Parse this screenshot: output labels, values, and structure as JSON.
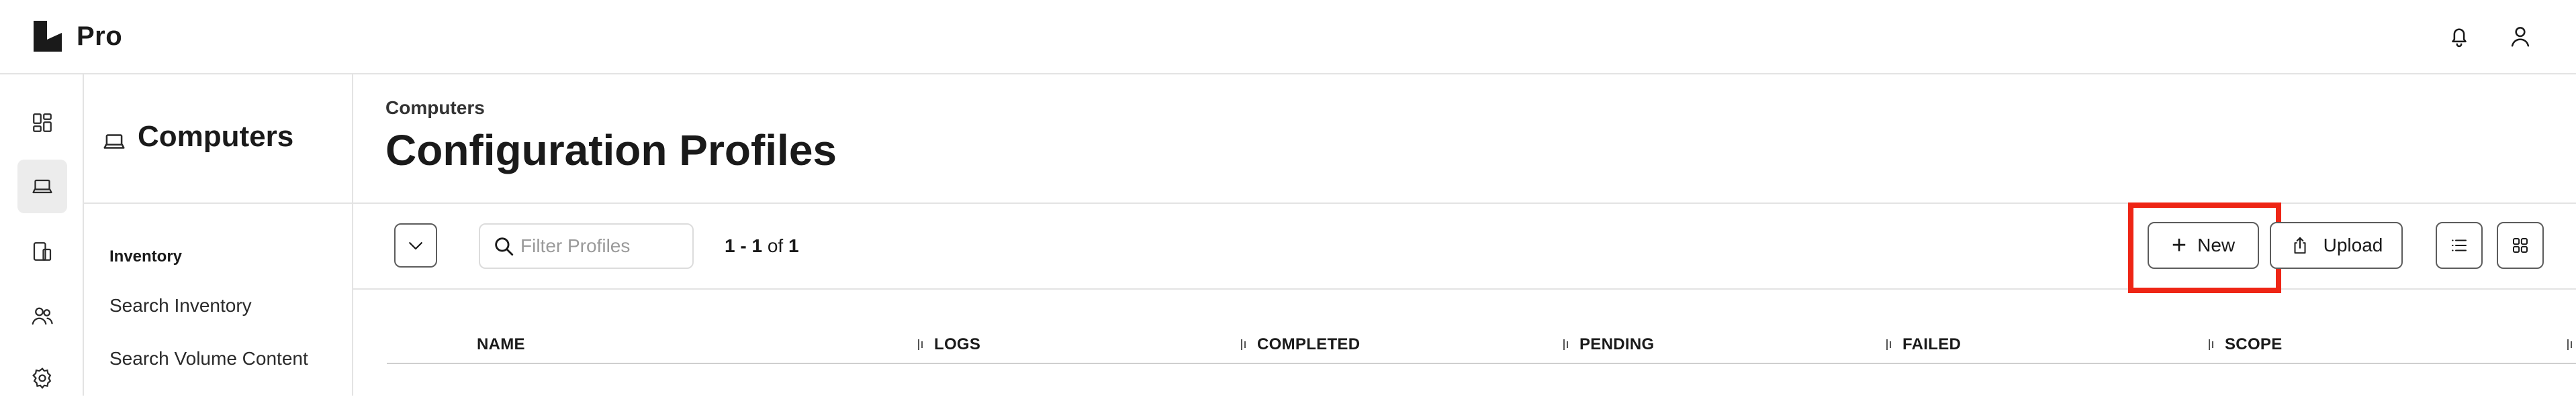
{
  "app": {
    "name": "Pro"
  },
  "sidebar_section": {
    "title": "Computers",
    "group_label": "Inventory",
    "links": [
      "Search Inventory",
      "Search Volume Content"
    ]
  },
  "page": {
    "breadcrumb": "Computers",
    "title": "Configuration Profiles"
  },
  "toolbar": {
    "filter_placeholder": "Filter Profiles",
    "range": "1 - 1",
    "of": "of",
    "total": "1",
    "new_label": "New",
    "upload_label": "Upload"
  },
  "table": {
    "columns": [
      "NAME",
      "LOGS",
      "COMPLETED",
      "PENDING",
      "FAILED",
      "SCOPE"
    ]
  },
  "icons": {
    "rail": [
      "dashboard-icon",
      "computer-icon",
      "devices-icon",
      "users-icon",
      "settings-icon"
    ],
    "top": [
      "bell-icon",
      "user-icon"
    ]
  },
  "colors": {
    "highlight": "#ee2515",
    "border": "#e3e3e3",
    "active_rail": "#ececec"
  }
}
